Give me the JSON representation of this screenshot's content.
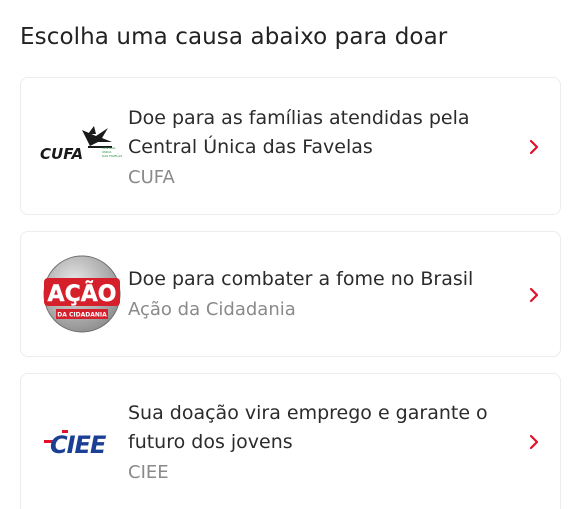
{
  "heading": "Escolha uma causa abaixo para doar",
  "causes": [
    {
      "title_line1": "Doe para as famílias atendidas pela",
      "title_line2": "Central Única das Favelas",
      "org": "CUFA",
      "logo_text": "CUFA",
      "logo_small": "CENTRAL ÚNICA DAS FAVELAS",
      "logo_icon": "cufa-bird-logo"
    },
    {
      "title_line1": "Doe para combater a fome no Brasil",
      "org": "Ação da Cidadania",
      "logo_text": "AÇÃO",
      "logo_small": "DA CIDADANIA",
      "logo_icon": "acao-da-cidadania-logo"
    },
    {
      "title_line1": "Sua doação vira emprego e garante o",
      "title_line2": "futuro dos jovens",
      "org": "CIEE",
      "logo_text": "CIEE",
      "logo_icon": "ciee-logo"
    }
  ],
  "colors": {
    "accent": "#e3102c",
    "ciee_blue": "#1b3f94",
    "cufa_green": "#1f8a3b"
  },
  "icons": {
    "chevron": "chevron-right-icon"
  }
}
